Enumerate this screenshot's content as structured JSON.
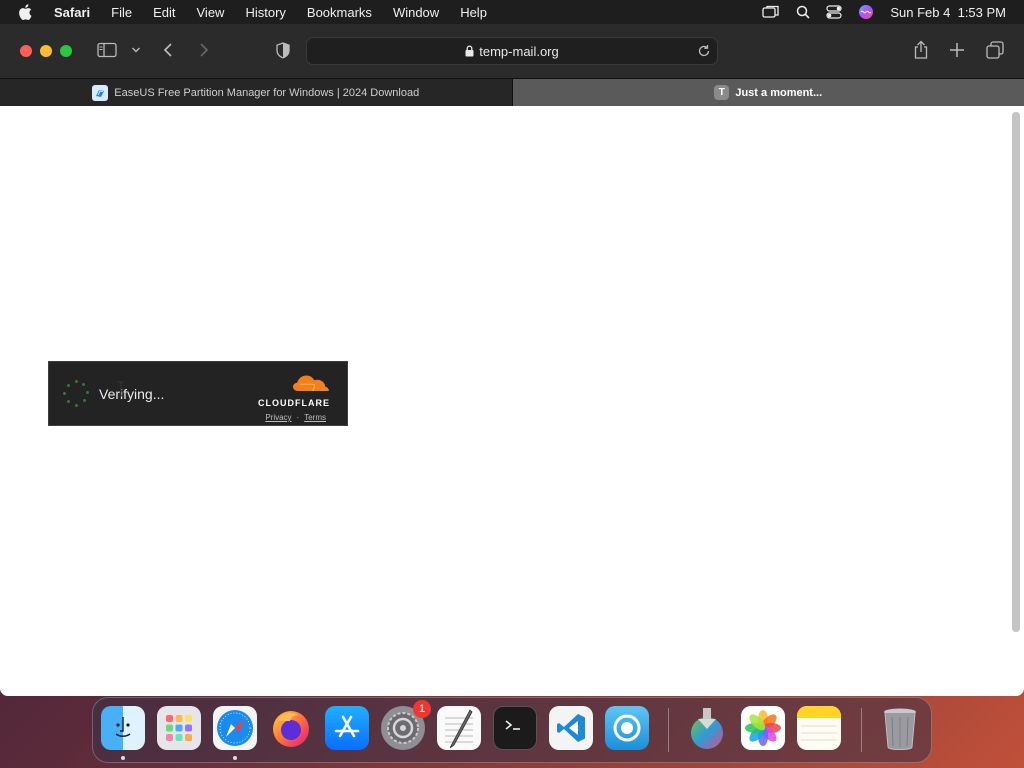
{
  "menubar": {
    "app_name": "Safari",
    "items": [
      "File",
      "Edit",
      "View",
      "History",
      "Bookmarks",
      "Window",
      "Help"
    ],
    "clock": "Sun Feb 4  1:53 PM"
  },
  "toolbar": {
    "address": "temp-mail.org"
  },
  "tabs": [
    {
      "title": "EaseUS Free Partition Manager for Windows | 2024 Download",
      "favicon": "easeus-icon"
    },
    {
      "title": "Just a moment...",
      "favicon": "T"
    }
  ],
  "cloudflare": {
    "status": "Verifying...",
    "brand": "CLOUDFLARE",
    "privacy": "Privacy",
    "separator": "·",
    "terms": "Terms"
  },
  "dock": {
    "badge_count": "1",
    "apps": [
      "finder-icon",
      "launchpad-icon",
      "safari-icon",
      "firefox-icon",
      "app-store-icon",
      "system-settings-icon",
      "textedit-icon",
      "terminal-icon",
      "vscode-icon",
      "proxyman-icon",
      "downloads-icon",
      "photos-icon",
      "notes-icon",
      "trash-icon"
    ]
  },
  "colors": {
    "menubar": "#1e1e1e",
    "toolbar": "#2b2b2b",
    "active_tab": "#5a5a5a",
    "cloudflare_orange": "#f38020",
    "badge_red": "#f0372f"
  }
}
